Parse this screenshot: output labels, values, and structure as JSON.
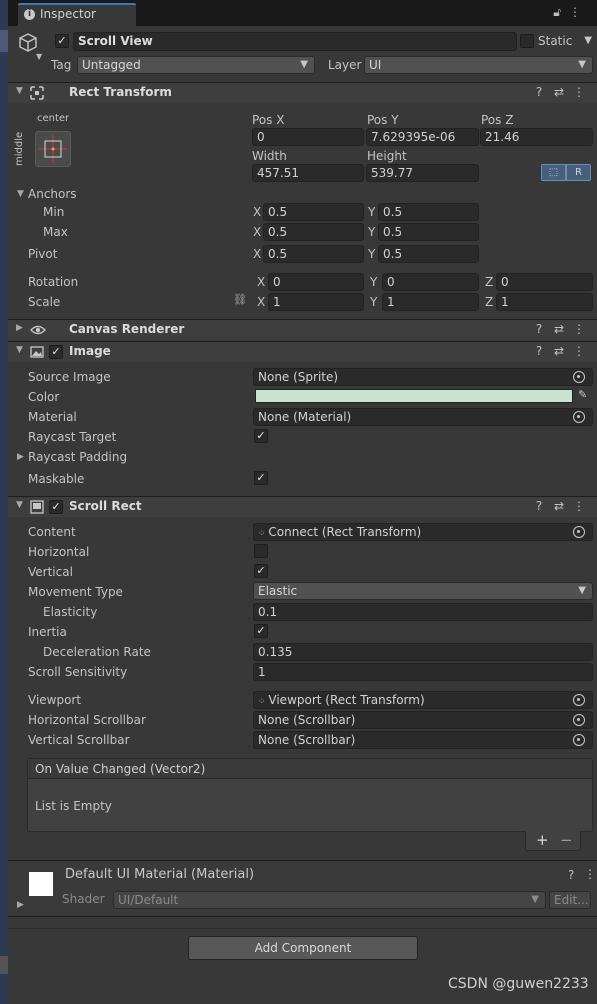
{
  "tab": {
    "label": "Inspector"
  },
  "header": {
    "object_name": "Scroll View",
    "static_label": "Static",
    "tag_label": "Tag",
    "tag_value": "Untagged",
    "layer_label": "Layer",
    "layer_value": "UI"
  },
  "rect_transform": {
    "title": "Rect Transform",
    "anchor_h": "center",
    "anchor_v": "middle",
    "pos_x_label": "Pos X",
    "pos_x": "0",
    "pos_y_label": "Pos Y",
    "pos_y": "7.629395e-06",
    "pos_z_label": "Pos Z",
    "pos_z": "21.46",
    "width_label": "Width",
    "width": "457.51",
    "height_label": "Height",
    "height": "539.77",
    "raw_btn": "R",
    "anchors_label": "Anchors",
    "min_label": "Min",
    "min_x": "0.5",
    "min_y": "0.5",
    "max_label": "Max",
    "max_x": "0.5",
    "max_y": "0.5",
    "pivot_label": "Pivot",
    "pivot_x": "0.5",
    "pivot_y": "0.5",
    "rotation_label": "Rotation",
    "rot_x": "0",
    "rot_y": "0",
    "rot_z": "0",
    "scale_label": "Scale",
    "scale_x": "1",
    "scale_y": "1",
    "scale_z": "1",
    "x": "X",
    "y": "Y",
    "z": "Z"
  },
  "canvas_renderer": {
    "title": "Canvas Renderer"
  },
  "image": {
    "title": "Image",
    "source_image_label": "Source Image",
    "source_image": "None (Sprite)",
    "color_label": "Color",
    "color_value": "#c9e3d3",
    "material_label": "Material",
    "material": "None (Material)",
    "raycast_target_label": "Raycast Target",
    "raycast_padding_label": "Raycast Padding",
    "maskable_label": "Maskable"
  },
  "scroll_rect": {
    "title": "Scroll Rect",
    "content_label": "Content",
    "content": "Connect (Rect Transform)",
    "horizontal_label": "Horizontal",
    "vertical_label": "Vertical",
    "movement_type_label": "Movement Type",
    "movement_type": "Elastic",
    "elasticity_label": "Elasticity",
    "elasticity": "0.1",
    "inertia_label": "Inertia",
    "deceleration_rate_label": "Deceleration Rate",
    "deceleration_rate": "0.135",
    "scroll_sensitivity_label": "Scroll Sensitivity",
    "scroll_sensitivity": "1",
    "viewport_label": "Viewport",
    "viewport": "Viewport (Rect Transform)",
    "h_scrollbar_label": "Horizontal Scrollbar",
    "h_scrollbar": "None (Scrollbar)",
    "v_scrollbar_label": "Vertical Scrollbar",
    "v_scrollbar": "None (Scrollbar)",
    "event_title": "On Value Changed (Vector2)",
    "event_empty": "List is Empty",
    "plus": "+",
    "minus": "−"
  },
  "material_section": {
    "title": "Default UI Material (Material)",
    "shader_label": "Shader",
    "shader_value": "UI/Default",
    "edit_button": "Edit..."
  },
  "add_component": "Add Component",
  "watermark": "CSDN @guwen2233",
  "colors": {
    "accent": "#3a79bb",
    "panel": "#383838",
    "field": "#2a2a2a"
  }
}
